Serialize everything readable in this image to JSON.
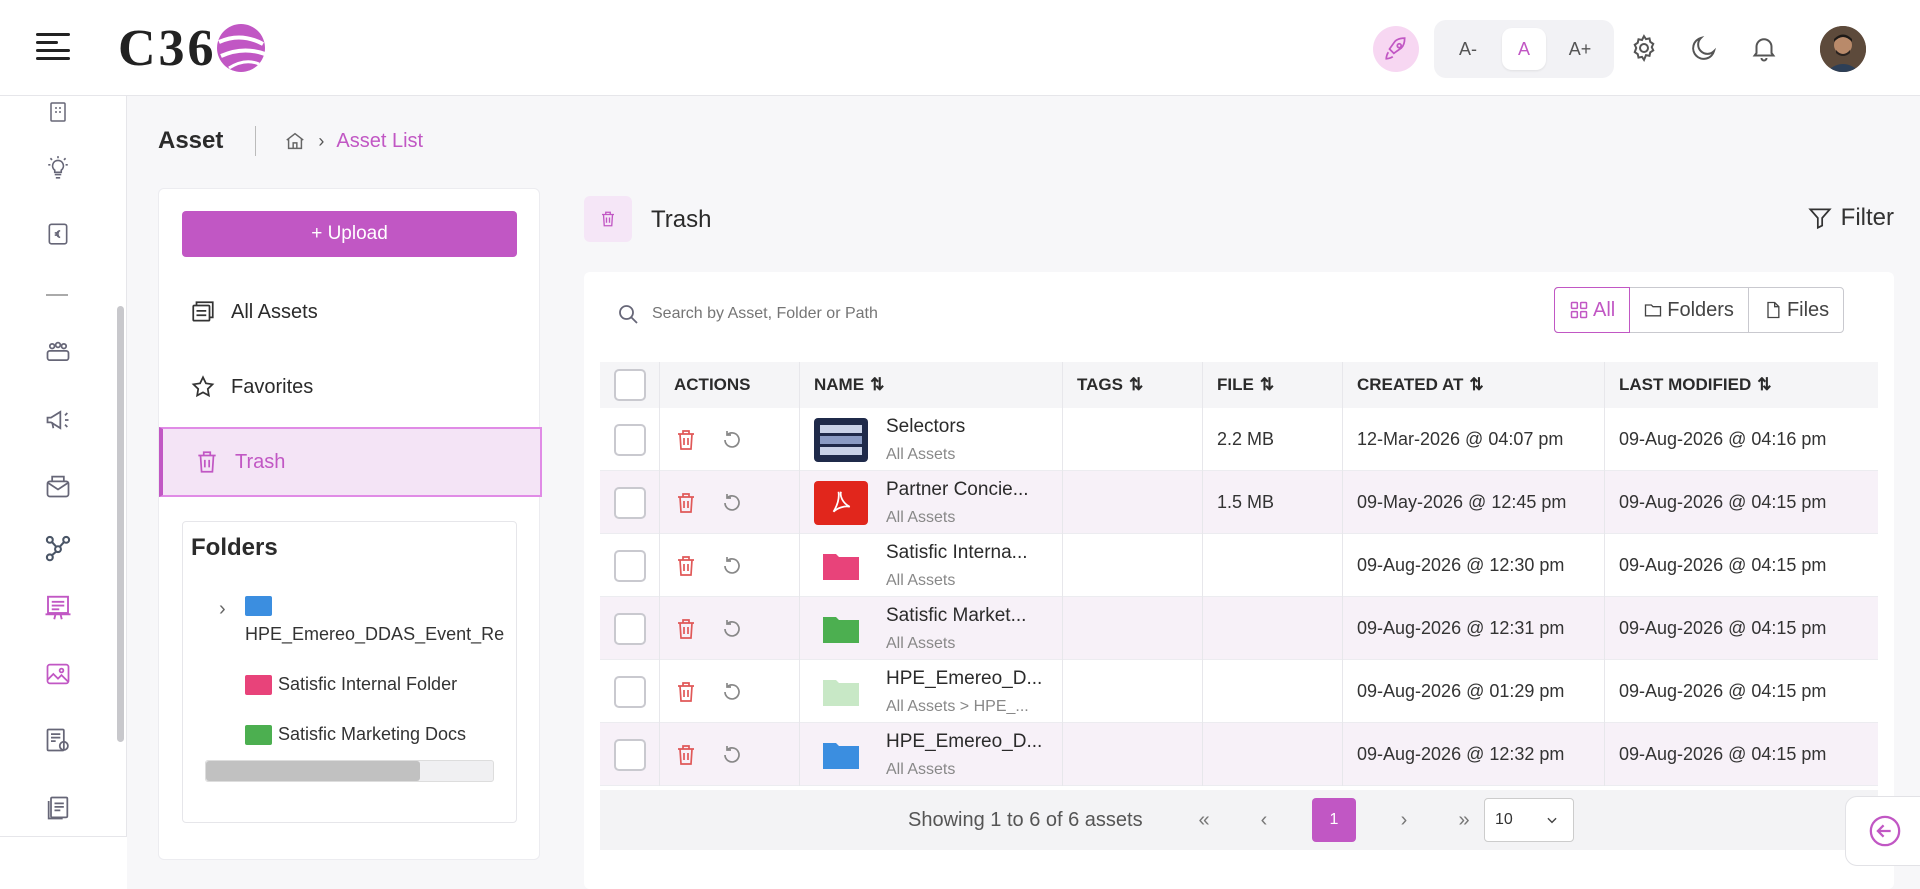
{
  "header": {
    "logo_text": "C36",
    "font_small": "A-",
    "font_normal": "A",
    "font_large": "A+"
  },
  "page": {
    "title": "Asset",
    "breadcrumb_current": "Asset List"
  },
  "left_panel": {
    "upload_label": "+ Upload",
    "nav": [
      {
        "label": "All Assets",
        "icon": "all-assets-icon"
      },
      {
        "label": "Favorites",
        "icon": "star-icon"
      },
      {
        "label": "Trash",
        "icon": "trash-icon",
        "active": true
      }
    ],
    "folders_title": "Folders",
    "folders": [
      {
        "label": "HPE_Emereo_DDAS_Event_Re",
        "color": "#3b8ee0",
        "expandable": true
      },
      {
        "label": "Satisfic Internal Folder",
        "color": "#e8437a"
      },
      {
        "label": "Satisfic Marketing Docs",
        "color": "#4caf50"
      }
    ]
  },
  "main": {
    "title": "Trash",
    "filter_label": "Filter",
    "search_placeholder": "Search by Asset, Folder or Path",
    "view_tabs": [
      "All",
      "Folders",
      "Files"
    ],
    "columns": [
      "ACTIONS",
      "NAME",
      "TAGS",
      "FILE",
      "CREATED AT",
      "LAST MODIFIED"
    ],
    "rows": [
      {
        "name": "Selectors",
        "path": "All Assets",
        "tags": "",
        "file": "2.2 MB",
        "created": "12-Mar-2026 @ 04:07 pm",
        "modified": "09-Aug-2026 @ 04:16 pm",
        "type": "image"
      },
      {
        "name": "Partner Concie...",
        "path": "All Assets",
        "tags": "",
        "file": "1.5 MB",
        "created": "09-May-2026 @ 12:45 pm",
        "modified": "09-Aug-2026 @ 04:15 pm",
        "type": "pdf"
      },
      {
        "name": "Satisfic Interna...",
        "path": "All Assets",
        "tags": "",
        "file": "",
        "created": "09-Aug-2026 @ 12:30 pm",
        "modified": "09-Aug-2026 @ 04:15 pm",
        "type": "folder-pink"
      },
      {
        "name": "Satisfic Market...",
        "path": "All Assets",
        "tags": "",
        "file": "",
        "created": "09-Aug-2026 @ 12:31 pm",
        "modified": "09-Aug-2026 @ 04:15 pm",
        "type": "folder-green"
      },
      {
        "name": "HPE_Emereo_D...",
        "path": "All Assets > HPE_...",
        "tags": "",
        "file": "",
        "created": "09-Aug-2026 @ 01:29 pm",
        "modified": "09-Aug-2026 @ 04:15 pm",
        "type": "folder-lightgreen"
      },
      {
        "name": "HPE_Emereo_D...",
        "path": "All Assets",
        "tags": "",
        "file": "",
        "created": "09-Aug-2026 @ 12:32 pm",
        "modified": "09-Aug-2026 @ 04:15 pm",
        "type": "folder-blue"
      }
    ],
    "pagination": {
      "summary": "Showing 1 to 6 of 6 assets",
      "current_page": "1",
      "page_size": "10"
    }
  },
  "colors": {
    "accent": "#c157c4",
    "accent_light": "#f4e4f6",
    "delete_red": "#e05858"
  }
}
